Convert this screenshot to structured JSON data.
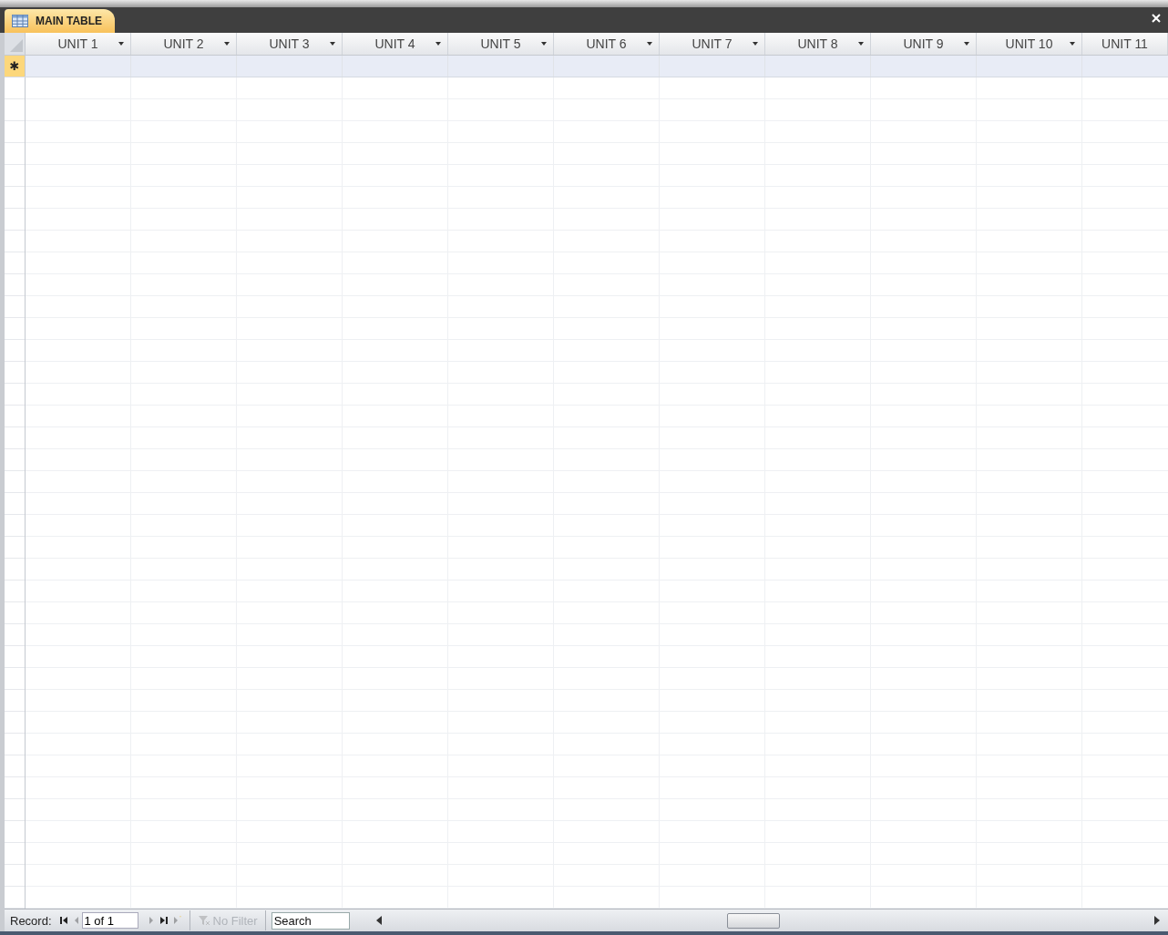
{
  "document_tab": {
    "title": "MAIN TABLE"
  },
  "table": {
    "columns": [
      {
        "label": "UNIT 1",
        "dropdown": true
      },
      {
        "label": "UNIT 2",
        "dropdown": true
      },
      {
        "label": "UNIT 3",
        "dropdown": true
      },
      {
        "label": "UNIT 4",
        "dropdown": true
      },
      {
        "label": "UNIT 5",
        "dropdown": true
      },
      {
        "label": "UNIT 6",
        "dropdown": true
      },
      {
        "label": "UNIT 7",
        "dropdown": true
      },
      {
        "label": "UNIT 8",
        "dropdown": true
      },
      {
        "label": "UNIT 9",
        "dropdown": true
      },
      {
        "label": "UNIT 10",
        "dropdown": true
      },
      {
        "label": "UNIT 11",
        "dropdown": false
      }
    ],
    "new_row_marker": "✱"
  },
  "status_bar": {
    "record_label": "Record:",
    "position": "1 of 1",
    "nav_buttons": [
      {
        "kind": "first",
        "disabled": false
      },
      {
        "kind": "prev",
        "disabled": true
      },
      {
        "kind": "next",
        "disabled": true
      },
      {
        "kind": "last",
        "disabled": false
      },
      {
        "kind": "new",
        "disabled": true
      }
    ],
    "filter": {
      "label": "No Filter",
      "disabled": true
    },
    "search": {
      "placeholder": "Search"
    }
  }
}
